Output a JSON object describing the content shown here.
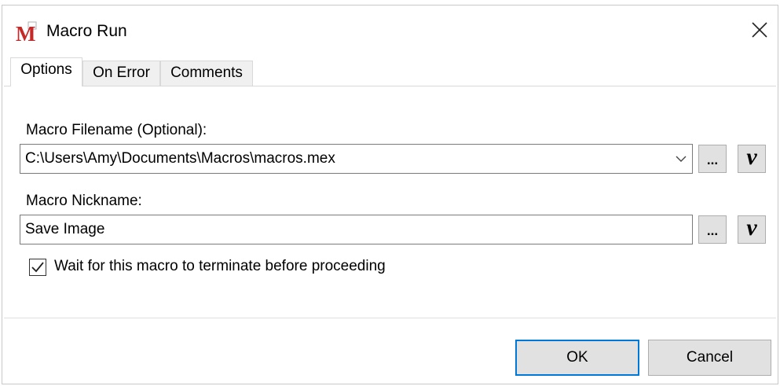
{
  "window": {
    "title": "Macro Run",
    "app_icon_letter": "M",
    "brand_color": "#c62828"
  },
  "tabs": [
    {
      "label": "Options",
      "active": true
    },
    {
      "label": "On Error",
      "active": false
    },
    {
      "label": "Comments",
      "active": false
    }
  ],
  "form": {
    "filename_label": "Macro Filename (Optional):",
    "filename_value": "C:\\Users\\Amy\\Documents\\Macros\\macros.mex",
    "nickname_label": "Macro Nickname:",
    "nickname_value": "Save Image",
    "browse_label": "...",
    "variable_label": "v",
    "wait_checkbox": {
      "label": "Wait for this macro to terminate before proceeding",
      "checked": true
    }
  },
  "buttons": {
    "ok": "OK",
    "cancel": "Cancel"
  },
  "colors": {
    "accent": "#0078d7",
    "button_face": "#e1e1e1"
  },
  "icons": [
    "close-icon",
    "chevron-down-icon",
    "check-icon"
  ]
}
